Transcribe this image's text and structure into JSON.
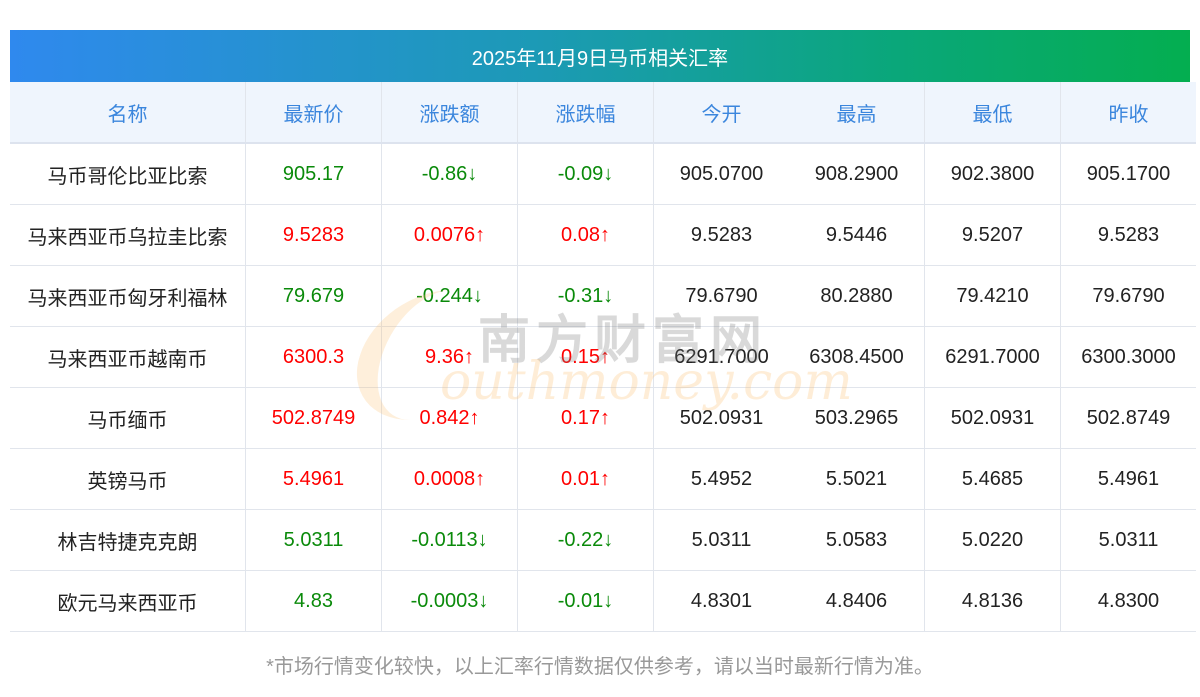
{
  "title": "2025年11月9日马币相关汇率",
  "columns": [
    "名称",
    "最新价",
    "涨跌额",
    "涨跌幅",
    "今开",
    "最高",
    "最低",
    "昨收"
  ],
  "rows": [
    {
      "name": "马币哥伦比亚比索",
      "latest": "905.17",
      "change": "-0.86↓",
      "pct": "-0.09↓",
      "open": "905.0700",
      "high": "908.2900",
      "low": "902.3800",
      "prev": "905.1700",
      "dir": "down"
    },
    {
      "name": "马来西亚币乌拉圭比索",
      "latest": "9.5283",
      "change": "0.0076↑",
      "pct": "0.08↑",
      "open": "9.5283",
      "high": "9.5446",
      "low": "9.5207",
      "prev": "9.5283",
      "dir": "up"
    },
    {
      "name": "马来西亚币匈牙利福林",
      "latest": "79.679",
      "change": "-0.244↓",
      "pct": "-0.31↓",
      "open": "79.6790",
      "high": "80.2880",
      "low": "79.4210",
      "prev": "79.6790",
      "dir": "down"
    },
    {
      "name": "马来西亚币越南币",
      "latest": "6300.3",
      "change": "9.36↑",
      "pct": "0.15↑",
      "open": "6291.7000",
      "high": "6308.4500",
      "low": "6291.7000",
      "prev": "6300.3000",
      "dir": "up"
    },
    {
      "name": "马币缅币",
      "latest": "502.8749",
      "change": "0.842↑",
      "pct": "0.17↑",
      "open": "502.0931",
      "high": "503.2965",
      "low": "502.0931",
      "prev": "502.8749",
      "dir": "up"
    },
    {
      "name": "英镑马币",
      "latest": "5.4961",
      "change": "0.0008↑",
      "pct": "0.01↑",
      "open": "5.4952",
      "high": "5.5021",
      "low": "5.4685",
      "prev": "5.4961",
      "dir": "up"
    },
    {
      "name": "林吉特捷克克朗",
      "latest": "5.0311",
      "change": "-0.0113↓",
      "pct": "-0.22↓",
      "open": "5.0311",
      "high": "5.0583",
      "low": "5.0220",
      "prev": "5.0311",
      "dir": "down"
    },
    {
      "name": "欧元马来西亚币",
      "latest": "4.83",
      "change": "-0.0003↓",
      "pct": "-0.01↓",
      "open": "4.8301",
      "high": "4.8406",
      "low": "4.8136",
      "prev": "4.8300",
      "dir": "down"
    }
  ],
  "footer": "*市场行情变化较快，以上汇率行情数据仅供参考，请以当时最新行情为准。",
  "watermark": {
    "cn": "南方财富网",
    "en": "outhmoney.com"
  },
  "colors": {
    "up": "#ff0000",
    "down": "#0a8a0a",
    "header_text": "#3b86dd"
  }
}
